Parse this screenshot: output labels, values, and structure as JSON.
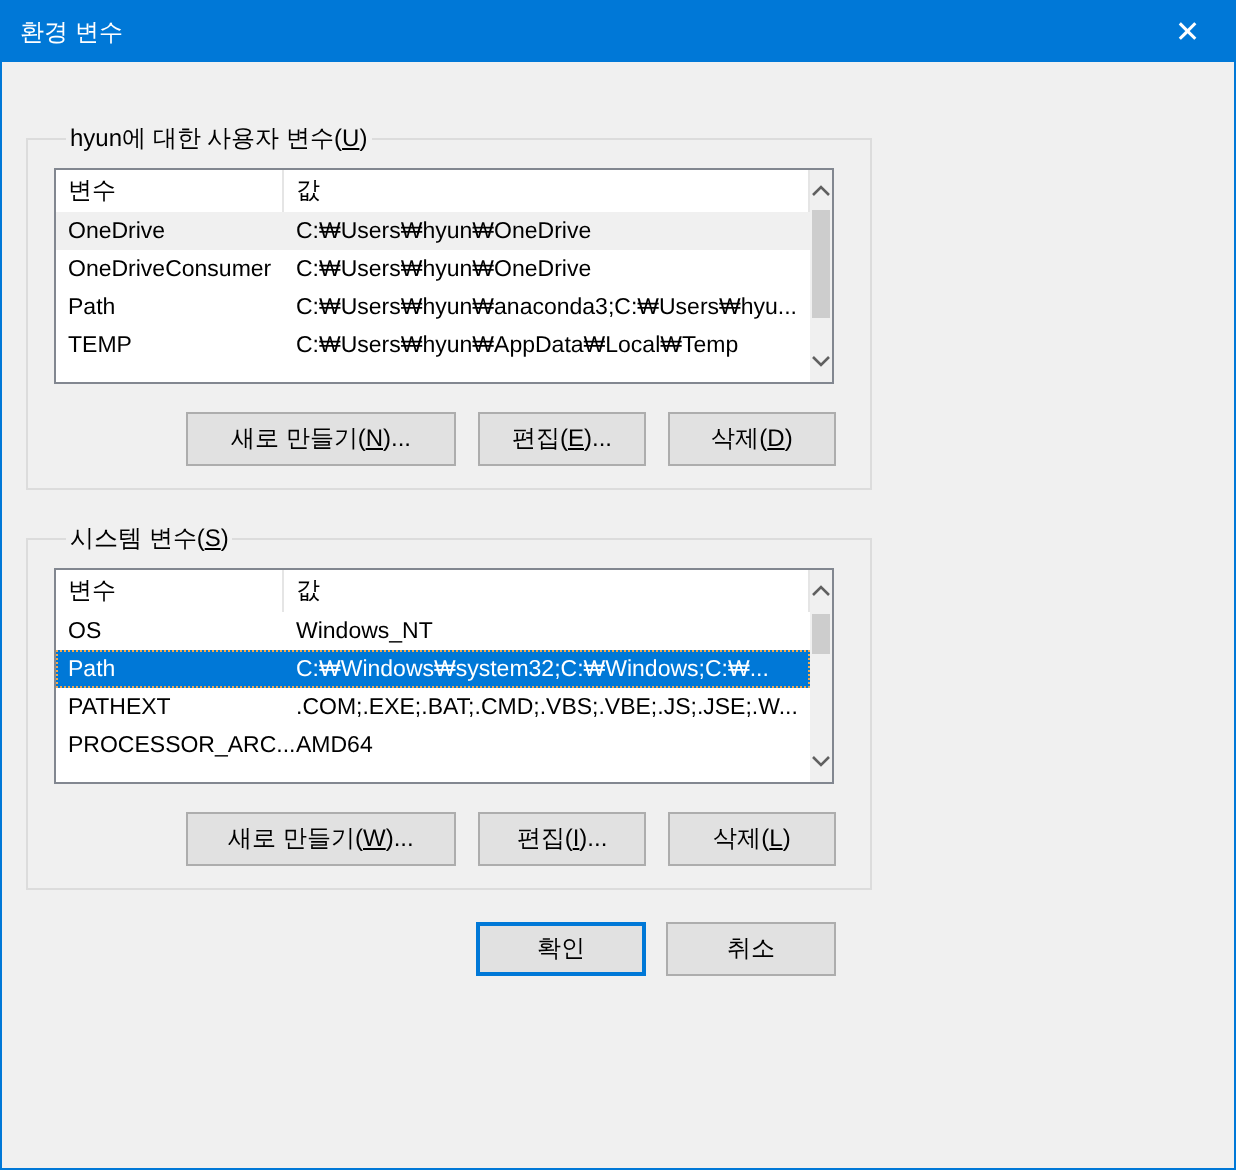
{
  "window": {
    "title": "환경 변수",
    "close": "✕"
  },
  "groups": [
    {
      "title": {
        "prefix": "hyun에 대한 사용자 변수(",
        "key": "U",
        "suffix": ")"
      },
      "focused": false,
      "columns": [
        "변수",
        "값"
      ],
      "rows": [
        {
          "name": "OneDrive",
          "value": "C:₩Users₩hyun₩OneDrive",
          "selected": true
        },
        {
          "name": "OneDriveConsumer",
          "value": "C:₩Users₩hyun₩OneDrive",
          "selected": false
        },
        {
          "name": "Path",
          "value": "C:₩Users₩hyun₩anaconda3;C:₩Users₩hyu...",
          "selected": false
        },
        {
          "name": "TEMP",
          "value": "C:₩Users₩hyun₩AppData₩Local₩Temp",
          "selected": false
        }
      ],
      "buttons": [
        {
          "prefix": "새로 만들기(",
          "key": "N",
          "suffix": ")...",
          "kind": "wide"
        },
        {
          "prefix": "편집(",
          "key": "E",
          "suffix": ")...",
          "kind": "normal"
        },
        {
          "prefix": "삭제(",
          "key": "D",
          "suffix": ")",
          "kind": "normal"
        }
      ]
    },
    {
      "title": {
        "prefix": "시스템 변수(",
        "key": "S",
        "suffix": ")"
      },
      "focused": true,
      "columns": [
        "변수",
        "값"
      ],
      "rows": [
        {
          "name": "OS",
          "value": "Windows_NT",
          "selected": false
        },
        {
          "name": "Path",
          "value": "C:₩Windows₩system32;C:₩Windows;C:₩...",
          "selected": true
        },
        {
          "name": "PATHEXT",
          "value": ".COM;.EXE;.BAT;.CMD;.VBS;.VBE;.JS;.JSE;.W...",
          "selected": false
        },
        {
          "name": "PROCESSOR_ARC...",
          "value": "AMD64",
          "selected": false
        }
      ],
      "buttons": [
        {
          "prefix": "새로 만들기(",
          "key": "W",
          "suffix": ")...",
          "kind": "wide"
        },
        {
          "prefix": "편집(",
          "key": "I",
          "suffix": ")...",
          "kind": "normal"
        },
        {
          "prefix": "삭제(",
          "key": "L",
          "suffix": ")",
          "kind": "normal"
        }
      ]
    }
  ],
  "footer": [
    {
      "label": "확인",
      "default": true
    },
    {
      "label": "취소",
      "default": false
    }
  ]
}
